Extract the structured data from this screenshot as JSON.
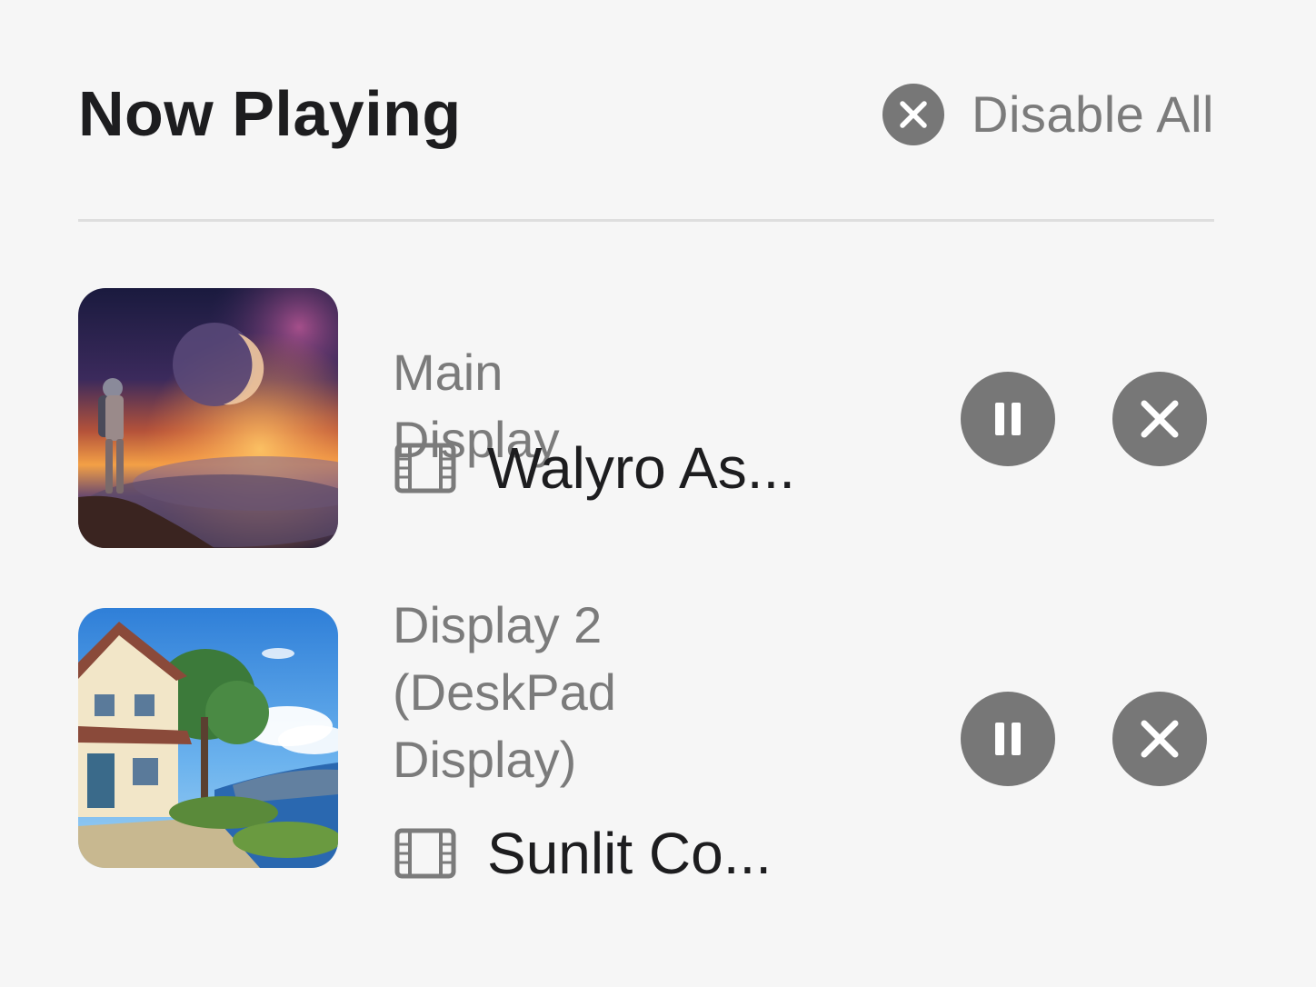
{
  "header": {
    "title": "Now Playing",
    "disable_all_label": "Disable All",
    "disable_all_icon": "close-circle-icon"
  },
  "colors": {
    "background": "#f6f6f6",
    "button_fill": "#777777",
    "secondary_text": "#7b7b7b",
    "primary_text": "#1d1d1f",
    "divider": "#dedede"
  },
  "items": [
    {
      "display_name": "Main Display",
      "media_icon": "film-icon",
      "media_title": "Walyro As...",
      "thumbnail": "astronaut-planet-sunset-artwork",
      "pause_icon": "pause-icon",
      "remove_icon": "close-icon"
    },
    {
      "display_name": "Display 2 (DeskPad Display)",
      "media_icon": "film-icon",
      "media_title": "Sunlit Co...",
      "thumbnail": "coastal-house-sunlit-artwork",
      "pause_icon": "pause-icon",
      "remove_icon": "close-icon"
    }
  ]
}
